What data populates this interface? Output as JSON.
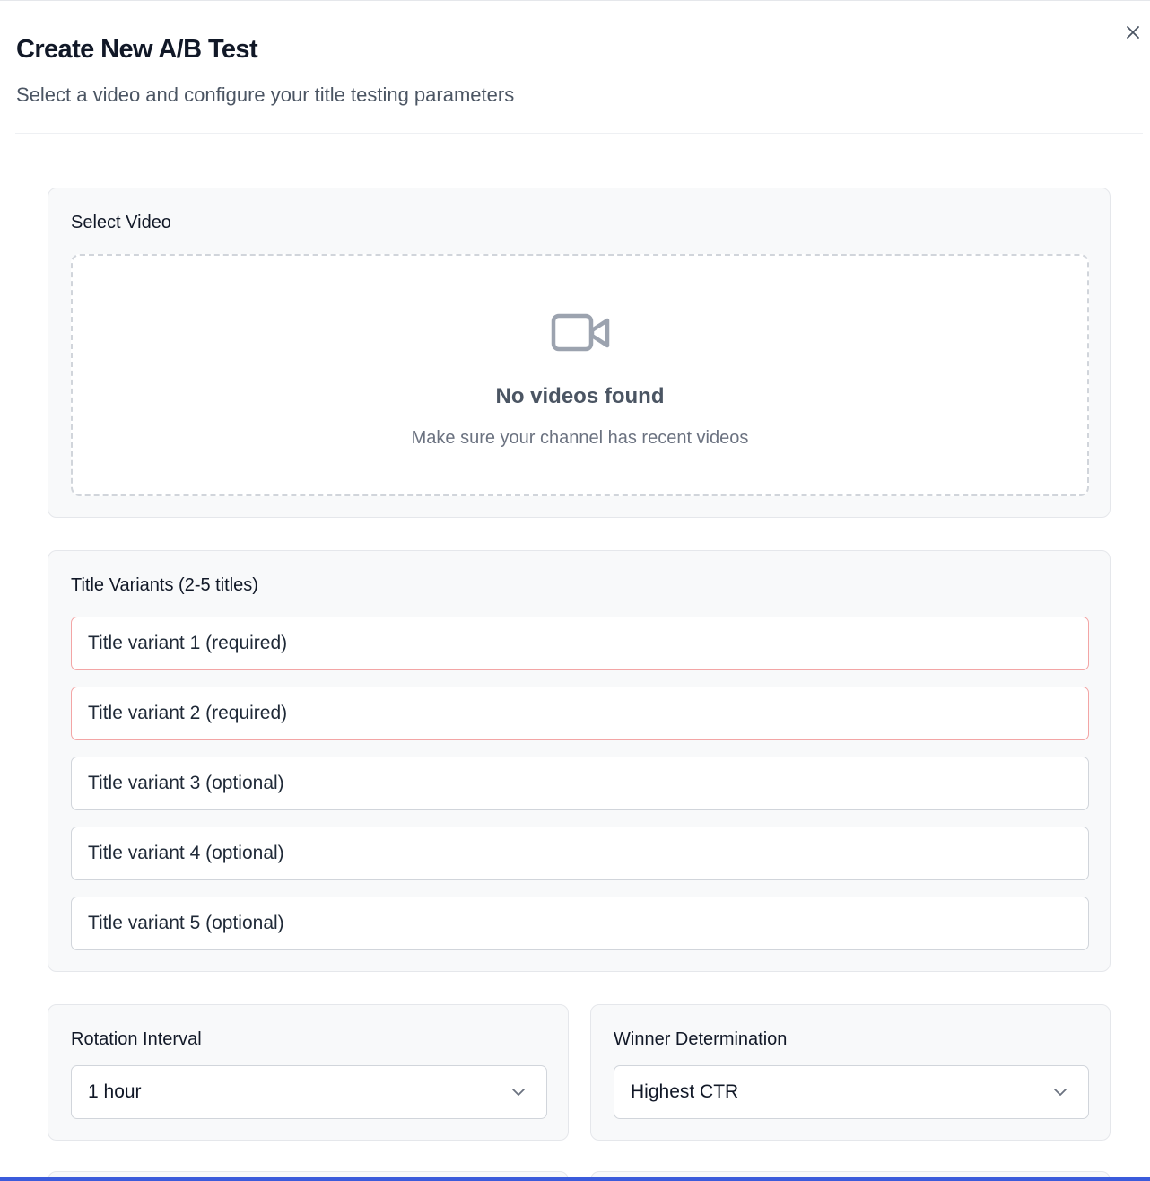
{
  "dialog": {
    "title": "Create New A/B Test",
    "subtitle": "Select a video and configure your title testing parameters",
    "close_icon": "close-icon"
  },
  "video_section": {
    "label": "Select Video",
    "icon": "video-camera-icon",
    "empty_title": "No videos found",
    "empty_subtitle": "Make sure your channel has recent videos"
  },
  "variants_section": {
    "label": "Title Variants (2-5 titles)",
    "inputs": [
      {
        "placeholder": "Title variant 1 (required)",
        "value": "",
        "required": true
      },
      {
        "placeholder": "Title variant 2 (required)",
        "value": "",
        "required": true
      },
      {
        "placeholder": "Title variant 3 (optional)",
        "value": "",
        "required": false
      },
      {
        "placeholder": "Title variant 4 (optional)",
        "value": "",
        "required": false
      },
      {
        "placeholder": "Title variant 5 (optional)",
        "value": "",
        "required": false
      }
    ]
  },
  "rotation": {
    "label": "Rotation Interval",
    "selected": "1 hour",
    "icon": "chevron-down-icon"
  },
  "winner": {
    "label": "Winner Determination",
    "selected": "Highest CTR",
    "icon": "chevron-down-icon"
  },
  "colors": {
    "required_border": "#f3a5a5",
    "card_bg": "#f8f9fa",
    "accent_bar": "#3b5bdb"
  }
}
